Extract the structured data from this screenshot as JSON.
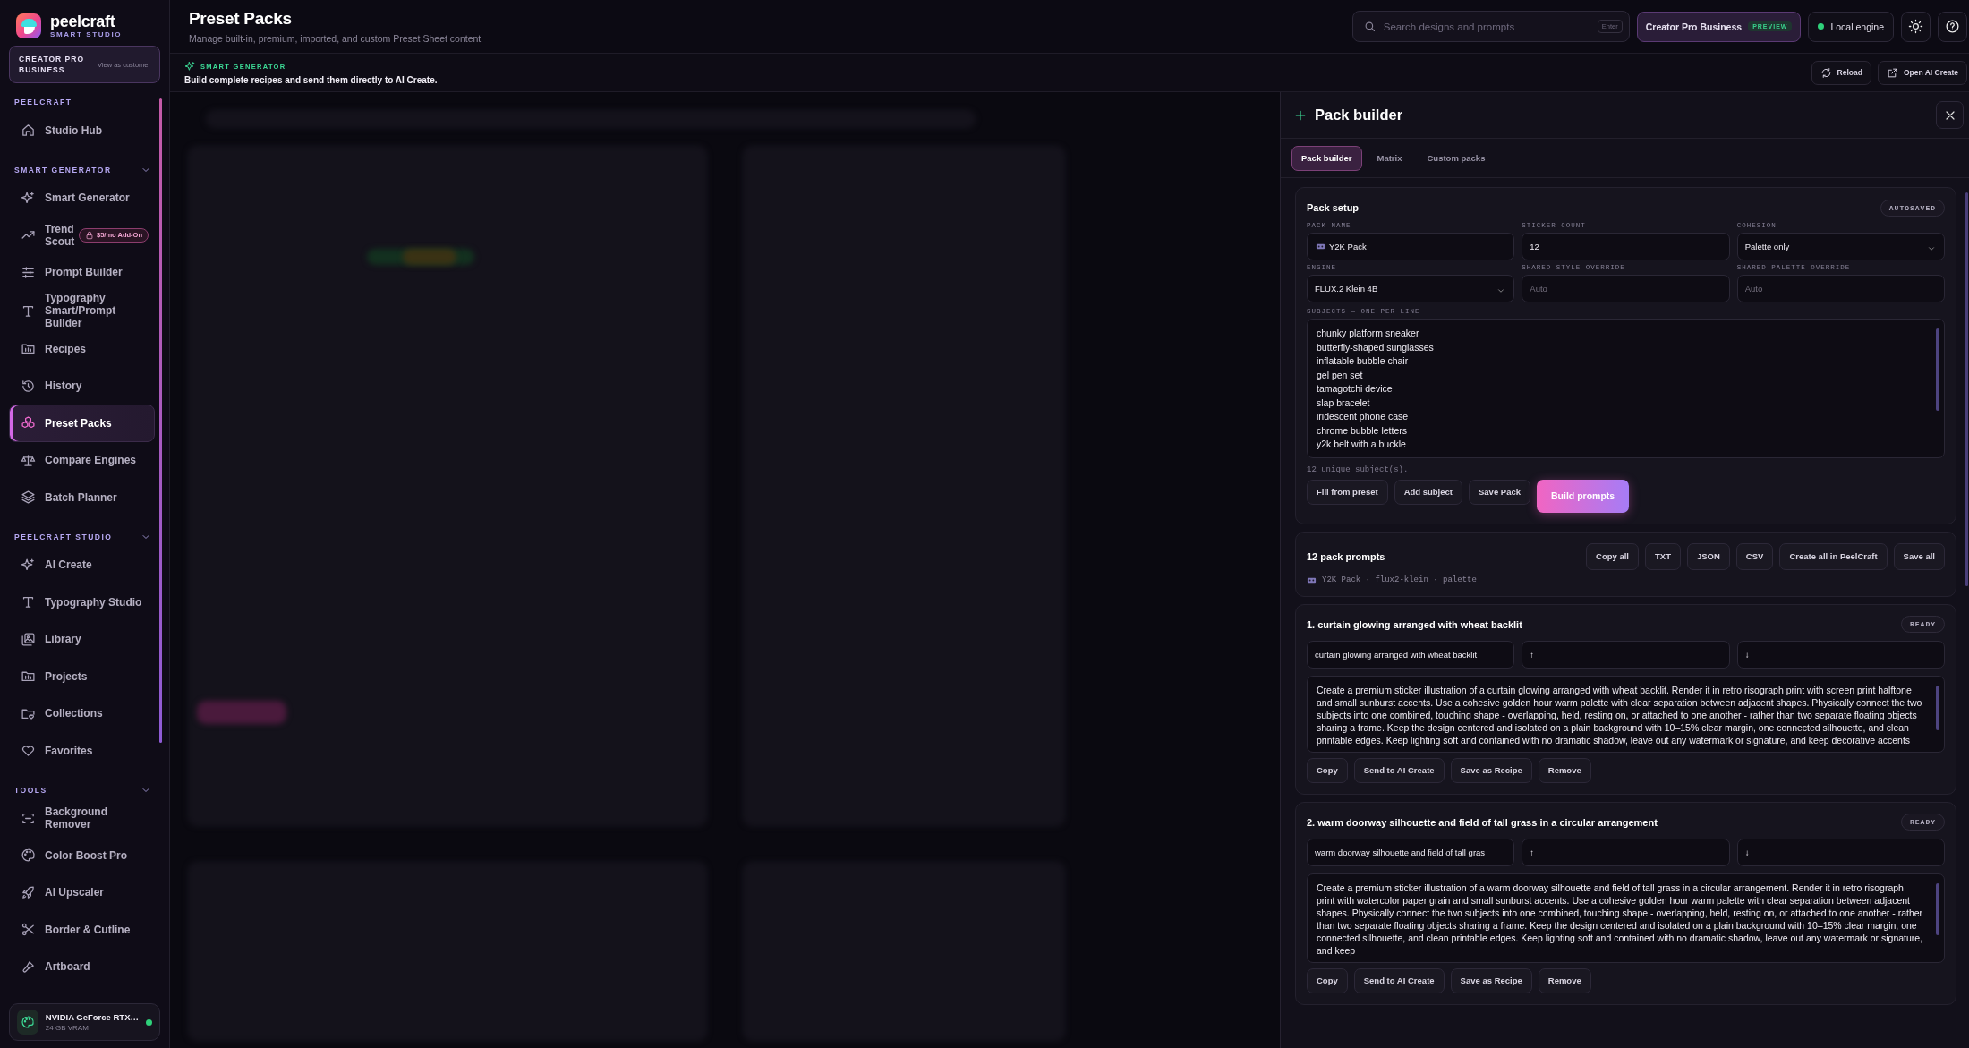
{
  "brand": {
    "name": "peelcraft",
    "tagline": "SMART STUDIO"
  },
  "plan_card": {
    "title": "CREATOR PRO BUSINESS",
    "link": "View as customer"
  },
  "sidebar": {
    "sections": [
      {
        "label": "PEELCRAFT",
        "items": [
          {
            "label": "Studio Hub",
            "selected": false
          }
        ]
      },
      {
        "label": "SMART GENERATOR",
        "expanded": true,
        "items": [
          {
            "label": "Smart Generator",
            "selected": false
          },
          {
            "label": "Trend Scout",
            "badge": "$5/mo Add-On",
            "selected": false
          },
          {
            "label": "Prompt Builder",
            "selected": false
          },
          {
            "label": "Typography Smart/Prompt Builder",
            "selected": false
          },
          {
            "label": "Recipes",
            "selected": false
          },
          {
            "label": "History",
            "selected": false
          },
          {
            "label": "Preset Packs",
            "selected": true
          },
          {
            "label": "Compare Engines",
            "selected": false
          },
          {
            "label": "Batch Planner",
            "selected": false
          }
        ]
      },
      {
        "label": "PEELCRAFT STUDIO",
        "expanded": true,
        "items": [
          {
            "label": "AI Create",
            "selected": false
          },
          {
            "label": "Typography Studio",
            "selected": false
          },
          {
            "label": "Library",
            "selected": false
          },
          {
            "label": "Projects",
            "selected": false
          },
          {
            "label": "Collections",
            "selected": false
          },
          {
            "label": "Favorites",
            "selected": false
          }
        ]
      },
      {
        "label": "TOOLS",
        "expanded": true,
        "items": [
          {
            "label": "Background Remover",
            "selected": false
          },
          {
            "label": "Color Boost Pro",
            "selected": false
          },
          {
            "label": "AI Upscaler",
            "selected": false
          },
          {
            "label": "Border & Cutline",
            "selected": false
          },
          {
            "label": "Artboard",
            "selected": false
          }
        ]
      }
    ]
  },
  "gpu": {
    "name": "NVIDIA GeForce RTX…",
    "detail": "24 GB VRAM",
    "online": true
  },
  "header": {
    "title": "Preset Packs",
    "subtitle": "Manage built-in, premium, imported, and custom Preset Sheet content",
    "search": {
      "placeholder": "Search designs and prompts",
      "shortcut": "Enter"
    },
    "plan_button": {
      "label": "Creator Pro Business",
      "badge": "PREVIEW"
    },
    "engine": {
      "label": "Local engine",
      "online": true
    }
  },
  "banner": {
    "eyebrow": "SMART GENERATOR",
    "text": "Build complete recipes and send them directly to AI Create.",
    "actions": [
      "Reload",
      "Open AI Create"
    ]
  },
  "drawer": {
    "title": "Pack builder",
    "tabs": [
      {
        "label": "Pack builder",
        "selected": true
      },
      {
        "label": "Matrix",
        "selected": false
      },
      {
        "label": "Custom packs",
        "selected": false
      }
    ],
    "setup": {
      "title": "Pack setup",
      "status": "AUTOSAVED",
      "fields": [
        {
          "label": "PACK NAME",
          "kind": "text",
          "value": "Y2K Pack",
          "emoji": true
        },
        {
          "label": "STICKER COUNT",
          "kind": "text",
          "value": "12"
        },
        {
          "label": "COHESION",
          "kind": "select",
          "value": "Palette only"
        },
        {
          "label": "ENGINE",
          "kind": "select",
          "value": "FLUX.2 Klein 4B"
        },
        {
          "label": "SHARED STYLE OVERRIDE",
          "kind": "text",
          "placeholder": "Auto"
        },
        {
          "label": "SHARED PALETTE OVERRIDE",
          "kind": "text",
          "placeholder": "Auto"
        }
      ],
      "subjects": {
        "label": "SUBJECTS — ONE PER LINE",
        "lines": [
          "chunky platform sneaker",
          "butterfly-shaped sunglasses",
          "inflatable bubble chair",
          "gel pen set",
          "tamagotchi device",
          "slap bracelet",
          "iridescent phone case",
          "chrome bubble letters",
          "y2k belt with a buckle"
        ]
      },
      "note": "12 unique subject(s).",
      "actions": [
        {
          "label": "Fill from preset",
          "primary": false
        },
        {
          "label": "Add subject",
          "primary": false
        },
        {
          "label": "Save Pack",
          "primary": false
        },
        {
          "label": "Build prompts",
          "primary": true
        }
      ]
    },
    "prompts_header": {
      "title": "12 pack prompts",
      "actions": [
        "Copy all",
        "TXT",
        "JSON",
        "CSV",
        "Create all in PeelCraft",
        "Save all"
      ],
      "meta": "Y2K Pack · flux2-klein · palette"
    },
    "prompts": [
      {
        "title": "1. curtain glowing arranged with wheat backlit",
        "status": "READY",
        "subject": "curtain glowing arranged with wheat backlit",
        "up": "↑",
        "down": "↓",
        "text": "Create a premium sticker illustration of a curtain glowing arranged with wheat backlit. Render it in retro risograph print with screen print halftone and small sunburst accents. Use a cohesive golden hour warm palette with clear separation between adjacent shapes. Physically connect the two subjects into one combined, touching shape - overlapping, held, resting on, or attached to one another - rather than two separate floating objects sharing a frame. Keep the design centered and isolated on a plain background with 10–15% clear margin, one connected silhouette, and clean printable edges. Keep lighting soft and contained with no dramatic shadow, leave out any watermark or signature, and keep decorative accents",
        "actions": [
          "Copy",
          "Send to AI Create",
          "Save as Recipe",
          "Remove"
        ]
      },
      {
        "title": "2. warm doorway silhouette and field of tall grass in a circular arrangement",
        "status": "READY",
        "subject": "warm doorway silhouette and field of tall gras",
        "up": "↑",
        "down": "↓",
        "text": "Create a premium sticker illustration of a warm doorway silhouette and field of tall grass in a circular arrangement. Render it in retro risograph print with watercolor paper grain and small sunburst accents. Use a cohesive golden hour warm palette with clear separation between adjacent shapes. Physically connect the two subjects into one combined, touching shape - overlapping, held, resting on, or attached to one another - rather than two separate floating objects sharing a frame. Keep the design centered and isolated on a plain background with 10–15% clear margin, one connected silhouette, and clean printable edges. Keep lighting soft and contained with no dramatic shadow, leave out any watermark or signature, and keep",
        "actions": [
          "Copy",
          "Send to AI Create",
          "Save as Recipe",
          "Remove"
        ]
      }
    ]
  }
}
